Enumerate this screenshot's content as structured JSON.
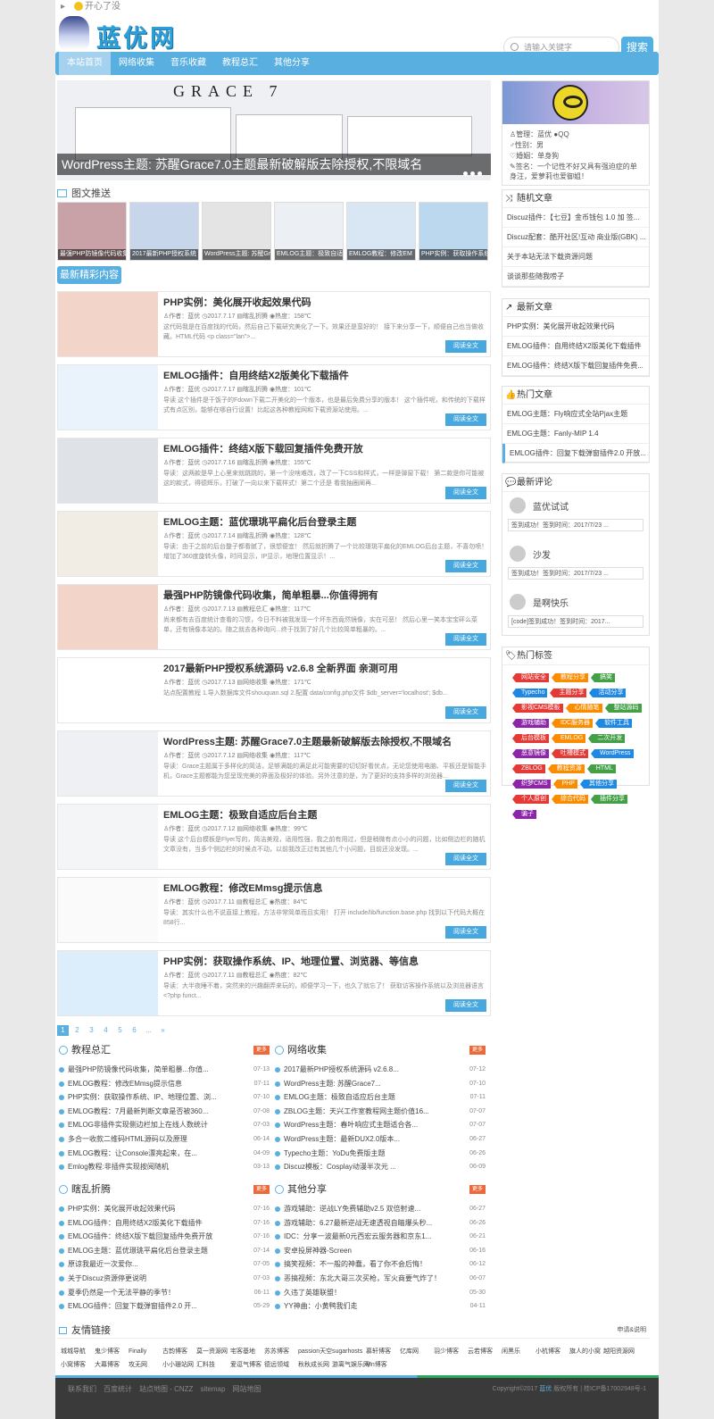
{
  "topbar": {
    "text": "开心了没"
  },
  "brand": {
    "name": "蓝优网",
    "accent": "#5aafe1"
  },
  "search": {
    "placeholder": "请输入关键字",
    "button": "搜索"
  },
  "nav": [
    "本站首页",
    "网络收集",
    "音乐收藏",
    "教程总汇",
    "其他分享"
  ],
  "slider": {
    "headline": "GRACE 7",
    "caption": "WordPress主题: 苏醒Grace7.0主题最新破解版去除授权,不限域名"
  },
  "recommend": {
    "title": "图文推送",
    "items": [
      "最强PHP防镜像代码收集",
      "2017最新PHP授权系统",
      "WordPress主题: 苏醒Gr",
      "EMLOG主题：极致自适",
      "EMLOG教程：修改EM",
      "PHP实例：获取操作系统"
    ]
  },
  "latest_badge": "最新精彩内容",
  "posts": [
    {
      "title": "PHP实例：美化展开收起效果代码",
      "author": "作者：蓝优",
      "date": "2017.7.17",
      "cat": "瞎乱折腾",
      "heat": "热度：158℃",
      "excerpt": "这代码我是在百度找的代码，然后自己下载研究美化了一下。效果还是蛮好的！ 接下来分享一下，顺便自己也当做收藏。HTML代码 <p class=\"lan\">...",
      "btn": "阅读全文"
    },
    {
      "title": "EMLOG插件：自用终结X2版美化下载插件",
      "author": "作者：蓝优",
      "date": "2017.7.17",
      "cat": "瞎乱折腾",
      "heat": "热度：101℃",
      "excerpt": "导读 这个插件是干饭子的Fdown下载二开美化的一个版本，也是最后免费分享的版本！ 这个插件呢，和传统的下载样式有点区别，能够在哪自行设置！比起这各种教程网和下载资源站使用。...",
      "btn": "阅读全文"
    },
    {
      "title": "EMLOG插件：终结X版下载回复插件免费开放",
      "author": "作者：蓝优",
      "date": "2017.7.16",
      "cat": "瞎乱折腾",
      "heat": "热度：155℃",
      "excerpt": "导读：这两款是早上心里来就跳跳的，第一个没啥难改，改了一下CSS和样式，一样是弹窗下载！ 第二款是你可能被这的款式，得德辉乐，打破了一向以来下载样式！第二个还是 看我抽圈阐再...",
      "btn": "阅读全文"
    },
    {
      "title": "EMLOG主题：蓝优璟珧平扁化后台登录主题",
      "author": "作者：蓝优",
      "date": "2017.7.14",
      "cat": "瞎乱折腾",
      "heat": "热度：128℃",
      "excerpt": "导读：由于之前的后台整子都看腻了，很想便宜！ 然后就折腾了一个比较璟珧平扁化的EMLOG后台主题，不喜勿喷！ 增加了360度旋转头像，时间显示，IP显示，地理位置显示！...",
      "btn": "阅读全文"
    },
    {
      "title": "最强PHP防镜像代码收集，简单粗暴...你值得拥有",
      "author": "作者：蓝优",
      "date": "2017.7.13",
      "cat": "教程总汇",
      "heat": "热度：117℃",
      "excerpt": "尚来都有去百度统计查看的习惯，今日不料被我发现一个坏东西竟然镜像，实在可恶！ 然后心里一笑本宝宝砰么菜单，还有镜像本站的。随之就去各种询问...终于找到了好几个比较简单粗暴的。...",
      "btn": "阅读全文"
    },
    {
      "title": "2017最新PHP授权系统源码 v2.6.8 全新界面 亲测可用",
      "author": "作者：蓝优",
      "date": "2017.7.13",
      "cat": "网络收集",
      "heat": "热度：171℃",
      "excerpt": "站点配置教程 1.导入数据库文件shouquan.sql 2.配置 data/config.php文件 $db_server='localhost'; $db...",
      "btn": "阅读全文"
    },
    {
      "title": "WordPress主题: 苏醒Grace7.0主题最新破解版去除授权,不限域名",
      "author": "作者：蓝优",
      "date": "2017.7.12",
      "cat": "网络收集",
      "heat": "热度：117℃",
      "excerpt": "导读：Grace主题属于多样化的简洁，足够满能的满足此可能需要的切切好看优点，无论您使用电脑、平板还是智能手机，Grace主题都能为您呈现完美的界面及极好的体验。另外注意的是，为了更好的支持多样的浏览器...",
      "btn": "阅读全文"
    },
    {
      "title": "EMLOG主题：极致自适应后台主题",
      "author": "作者：蓝优",
      "date": "2017.7.12",
      "cat": "网络收集",
      "heat": "热度：99℃",
      "excerpt": "导读 这个后台模板是Flyer写的，简洁美观，适用性强，我之前有用过，但是稍微有点小小的问题，比如侧边栏的随机文章没有，当多个侧边栏的时候点不动，以前我改正过有其他几个小问题，目前还没发现。...",
      "btn": "阅读全文"
    },
    {
      "title": "EMLOG教程：修改EMmsg提示信息",
      "author": "作者：蓝优",
      "date": "2017.7.11",
      "cat": "教程总汇",
      "heat": "热度：84℃",
      "excerpt": "导读：其实什么也不说直接上教程，方法非常简单而且实用！ 打开 include/lib/function.base.php 找到以下代码大概在858行...",
      "btn": "阅读全文"
    },
    {
      "title": "PHP实例：获取操作系统、IP、地理位置、浏览器、等信息",
      "author": "作者：蓝优",
      "date": "2017.7.11",
      "cat": "教程总汇",
      "heat": "热度：82℃",
      "excerpt": "导读：大半夜睡不着，突然来的兴趣翻弄来玩的，顺便学习一下，也久了就忘了！ 获取访客操作系统以及浏览器语言 <?php funct...",
      "btn": "阅读全文"
    }
  ],
  "pager": [
    "1",
    "2",
    "3",
    "4",
    "5",
    "6",
    "...",
    "»"
  ],
  "cat_boxes": [
    {
      "title": "教程总汇",
      "more": "更多",
      "items": [
        [
          "最强PHP防镜像代码收集，简单粗暴...你值...",
          "07-13"
        ],
        [
          "EMLOG教程：修改EMmsg提示信息",
          "07-11"
        ],
        [
          "PHP实例：获取操作系统、IP、地理位置、浏...",
          "07-10"
        ],
        [
          "EMLOG教程：7月最新判断文章是否被360...",
          "07-08"
        ],
        [
          "EMLOG非插件实现侧边栏加上在线人数统计",
          "07-03"
        ],
        [
          "多合一收款二维码HTML源码以及原理",
          "06-14"
        ],
        [
          "EMLOG教程：让Console漂亮起来，在...",
          "04-09"
        ],
        [
          "Emlog教程:非插件实现按阅随机",
          "03-13"
        ]
      ]
    },
    {
      "title": "网络收集",
      "more": "更多",
      "items": [
        [
          "2017最新PHP授权系统源码 v2.6.8...",
          "07-12"
        ],
        [
          "WordPress主题: 苏醒Grace7...",
          "07-10"
        ],
        [
          "EMLOG主题：极致自适应后台主题",
          "07-11"
        ],
        [
          "ZBLOG主题：天兴工作室教程网主题价值16...",
          "07-07"
        ],
        [
          "WordPress主题：春叶响应式主题适合各...",
          "07-07"
        ],
        [
          "WordPress主题：最新DUX2.0版本...",
          "06-27"
        ],
        [
          "Typecho主题：YoDu免费版主题",
          "06-26"
        ],
        [
          "Discuz模板：Cosplay动漫半次元 ...",
          "06-09"
        ]
      ]
    },
    {
      "title": "瞎乱折腾",
      "more": "更多",
      "items": [
        [
          "PHP实例：美化展开收起效果代码",
          "07-16"
        ],
        [
          "EMLOG插件：自用终结X2版美化下载插件",
          "07-16"
        ],
        [
          "EMLOG插件：终结X版下载回复插件免费开放",
          "07-16"
        ],
        [
          "EMLOG主题：蓝优璟珧平扁化后台登录主题",
          "07-14"
        ],
        [
          "原谅我最近一次爱你...",
          "07-05"
        ],
        [
          "关于Discuz资源停更说明",
          "07-03"
        ],
        [
          "夏季仍然是一个无法平静的季节！",
          "06-11"
        ],
        [
          "EMLOG插件：回复下载弹窗插件2.0 开...",
          "05-29"
        ]
      ]
    },
    {
      "title": "其他分享",
      "more": "更多",
      "items": [
        [
          "游戏辅助：逆战LY免费辅助v2.5 双倍射速...",
          "06-27"
        ],
        [
          "游戏辅助：6.27最新逆战无速透视自瞄爆头秒...",
          "06-26"
        ],
        [
          "IDC：分享一波最新0元西宏云服务器和京东1...",
          "06-21"
        ],
        [
          "安卓投屏神器-Screen",
          "06-16"
        ],
        [
          "搞笑视频：不一般的神蠢，看了你不会后悔！",
          "06-12"
        ],
        [
          "恶搞视频：东北大哥三次买枪，军火商要气炸了！",
          "06-07"
        ],
        [
          "久违了英雄联盟！",
          "05-30"
        ],
        [
          "YY神曲：小黄鸭我们走",
          "04-11"
        ]
      ]
    }
  ],
  "profile": {
    "admin": "管理：蓝优",
    "qq": "QQ",
    "gender": "性别：男",
    "marriage": "婚姻：单身狗",
    "sign": "签名：一个记性不好又具有强迫症的单身汪，爱萝莉也爱御姐！"
  },
  "random": {
    "title": "随机文章",
    "items": [
      "Discuz插件：【七豆】金币钱包 1.0 加 签...",
      "Discuz配套：酷开社区!互动 商业版(GBK) ...",
      "关于本站无法下载资源问题",
      "谈谈那些随我唠子"
    ]
  },
  "newest": {
    "title": "最新文章",
    "items": [
      "PHP实例：美化展开收起效果代码",
      "EMLOG插件：自用终结X2版美化下载插件",
      "EMLOG插件：终结X版下载回复插件免费..."
    ]
  },
  "hot": {
    "title": "热门文章",
    "items": [
      "EMLOG主题：Fly响应式全站Pjax主题",
      "EMLOG主题：Fanly-MIP 1.4",
      "EMLOG插件：回复下载弹窗插件2.0 开放..."
    ]
  },
  "comments": {
    "title": "最新评论",
    "items": [
      {
        "name": "蓝优试试",
        "text": "签到成功！签到时间：2017/7/23 ..."
      },
      {
        "name": "沙发",
        "text": "签到成功！签到时间：2017/7/23 ..."
      },
      {
        "name": "是啊快乐",
        "text": "[code]签到成功！签到时间：2017..."
      }
    ]
  },
  "tags": {
    "title": "热门标签",
    "items": [
      [
        "网站安全",
        "#e53935"
      ],
      [
        "教程分享",
        "#fb8c00"
      ],
      [
        "搞笑",
        "#43a047"
      ],
      [
        "Typecho",
        "#1e88e5"
      ],
      [
        "主题分享",
        "#e53935"
      ],
      [
        "活动分享",
        "#1e88e5"
      ],
      [
        "影视CMS模板",
        "#e53935"
      ],
      [
        "心情随笔",
        "#fb8c00"
      ],
      [
        "整站源码",
        "#43a047"
      ],
      [
        "游戏辅助",
        "#8e24aa"
      ],
      [
        "IDC服务器",
        "#fb8c00"
      ],
      [
        "软件工具",
        "#1e88e5"
      ],
      [
        "后台模板",
        "#e53935"
      ],
      [
        "EMLOG",
        "#fb8c00"
      ],
      [
        "二次开发",
        "#43a047"
      ],
      [
        "恶意镜像",
        "#8e24aa"
      ],
      [
        "吐槽模式",
        "#e53935"
      ],
      [
        "WordPress",
        "#1e88e5"
      ],
      [
        "ZBLOG",
        "#e53935"
      ],
      [
        "教程资源",
        "#fb8c00"
      ],
      [
        "HTML",
        "#43a047"
      ],
      [
        "织梦CMS",
        "#8e24aa"
      ],
      [
        "PHP",
        "#fb8c00"
      ],
      [
        "其他分享",
        "#1e88e5"
      ],
      [
        "个人原创",
        "#e53935"
      ],
      [
        "综合代码",
        "#fb8c00"
      ],
      [
        "插件分享",
        "#43a047"
      ],
      [
        "骗子",
        "#8e24aa"
      ]
    ]
  },
  "friends": {
    "title": "友情链接",
    "apply": "申请&说明",
    "links": [
      "城城导航",
      "鬼少博客",
      "Finally",
      "古韵博客",
      "莫一资源网",
      "宅客基地",
      "苏苏博客",
      "passion天空",
      "sugarhosts",
      "慕轩博客",
      "亿库网",
      "羽少博客",
      "云若博客",
      "闲黑乐",
      "小杭博客",
      "旗人的小窝",
      "越阳资源网",
      "小窝博客",
      "大幕博客",
      "攻无网",
      "小小珊站网",
      "汇料技",
      "爱逗气博客",
      "德远领域",
      "秋秋成长网",
      "游离气娱乐网",
      "Mn博客"
    ]
  },
  "footer": {
    "links": [
      "联系我们",
      "百度统计",
      "站点地图 - CNZZ",
      "sitemap",
      "网站地图"
    ],
    "copyright": "Copyright©2017",
    "site": "蓝优",
    "tail": "版权所有 | 桂ICP备17002948号-1"
  }
}
